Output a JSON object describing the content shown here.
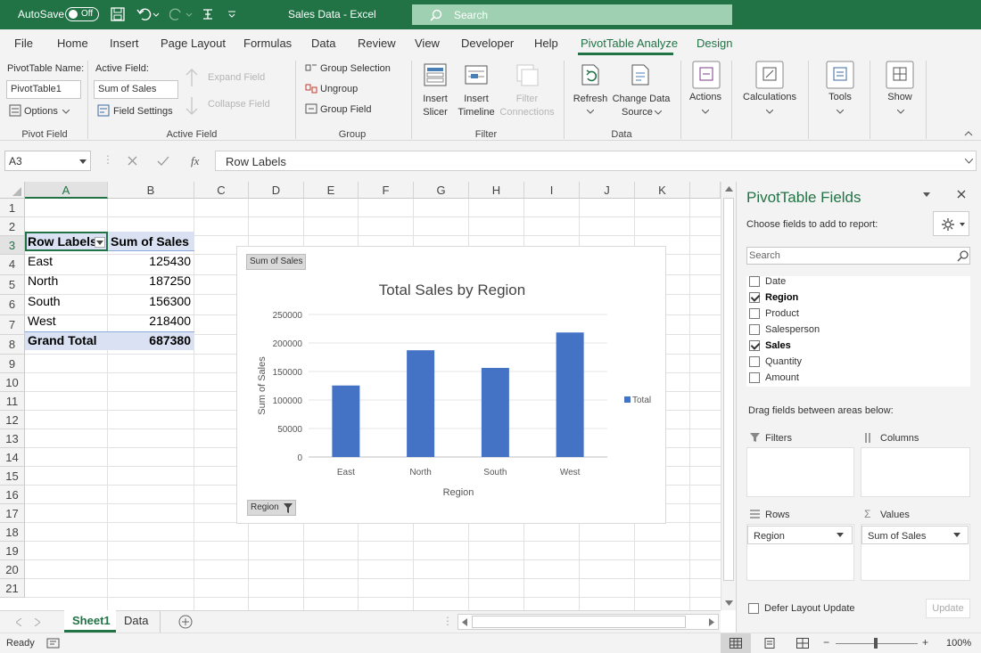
{
  "titlebar": {
    "autosave_label": "AutoSave",
    "autosave_state": "Off",
    "title": "Sales Data - Excel",
    "search_placeholder": "Search"
  },
  "tabs": [
    "File",
    "Home",
    "Insert",
    "Page Layout",
    "Formulas",
    "Data",
    "Review",
    "View",
    "Developer",
    "Help",
    "PivotTable Analyze",
    "Design"
  ],
  "ribbon": {
    "pivot_name_label": "PivotTable Name:",
    "pivot_name_value": "PivotTable1",
    "options_label": "Options",
    "group_pivot": "Pivot Field",
    "active_field_label": "Active Field:",
    "active_field_value": "Sum of Sales",
    "field_settings": "Field Settings",
    "expand_field": "Expand Field",
    "collapse_field": "Collapse Field",
    "group_active": "Active Field",
    "group_selection": "Group Selection",
    "ungroup": "Ungroup",
    "group_field": "Group Field",
    "group_group": "Group",
    "insert_slicer_1": "Insert",
    "insert_slicer_2": "Slicer",
    "insert_timeline_1": "Insert",
    "insert_timeline_2": "Timeline",
    "filter_conn_1": "Filter",
    "filter_conn_2": "Connections",
    "group_filter": "Filter",
    "refresh": "Refresh",
    "change_source_1": "Change Data",
    "change_source_2": "Source",
    "group_data": "Data",
    "actions": "Actions",
    "calculations": "Calculations",
    "tools": "Tools",
    "show": "Show"
  },
  "formula_bar": {
    "name_box": "A3",
    "fx": "fx",
    "content": "Row Labels"
  },
  "columns": [
    "A",
    "B",
    "C",
    "D",
    "E",
    "F",
    "G",
    "H",
    "I",
    "J",
    "K"
  ],
  "rows": [
    "1",
    "2",
    "3",
    "4",
    "5",
    "6",
    "7",
    "8",
    "9",
    "10",
    "11",
    "12",
    "13",
    "14",
    "15",
    "16",
    "17",
    "18",
    "19",
    "20",
    "21"
  ],
  "pivot": {
    "header_labels": "Row Labels",
    "header_values": "Sum of Sales",
    "rows": [
      {
        "label": "East",
        "value": "125430"
      },
      {
        "label": "North",
        "value": "187250"
      },
      {
        "label": "South",
        "value": "156300"
      },
      {
        "label": "West",
        "value": "218400"
      }
    ],
    "total_label": "Grand Total",
    "total_value": "687380"
  },
  "chart_data": {
    "type": "bar",
    "title": "Total Sales by Region",
    "xlabel": "Region",
    "ylabel": "Sum of Sales",
    "categories": [
      "East",
      "North",
      "South",
      "West"
    ],
    "series": [
      {
        "name": "Total",
        "values": [
          125430,
          187250,
          156300,
          218400
        ],
        "color": "#4472c4"
      }
    ],
    "ylim": [
      0,
      250000
    ],
    "yticks": [
      "0",
      "50000",
      "100000",
      "150000",
      "200000",
      "250000"
    ],
    "grid": true,
    "legend": "right",
    "field_button": "Sum of Sales",
    "axis_button": "Region"
  },
  "sheets": {
    "active": "Sheet1",
    "other": "Data"
  },
  "status": {
    "ready": "Ready",
    "zoom": "100%",
    "minus": "−",
    "plus": "+"
  },
  "pane": {
    "title": "PivotTable Fields",
    "subtitle": "Choose fields to add to report:",
    "search_placeholder": "Search",
    "fields": [
      {
        "name": "Date",
        "checked": false
      },
      {
        "name": "Region",
        "checked": true
      },
      {
        "name": "Product",
        "checked": false
      },
      {
        "name": "Salesperson",
        "checked": false
      },
      {
        "name": "Sales",
        "checked": true
      },
      {
        "name": "Quantity",
        "checked": false
      },
      {
        "name": "Amount",
        "checked": false
      }
    ],
    "drag_label": "Drag fields between areas below:",
    "filters": "Filters",
    "columns": "Columns",
    "rows": "Rows",
    "values": "Values",
    "rows_item": "Region",
    "values_item": "Sum of Sales",
    "defer": "Defer Layout Update",
    "update": "Update"
  }
}
